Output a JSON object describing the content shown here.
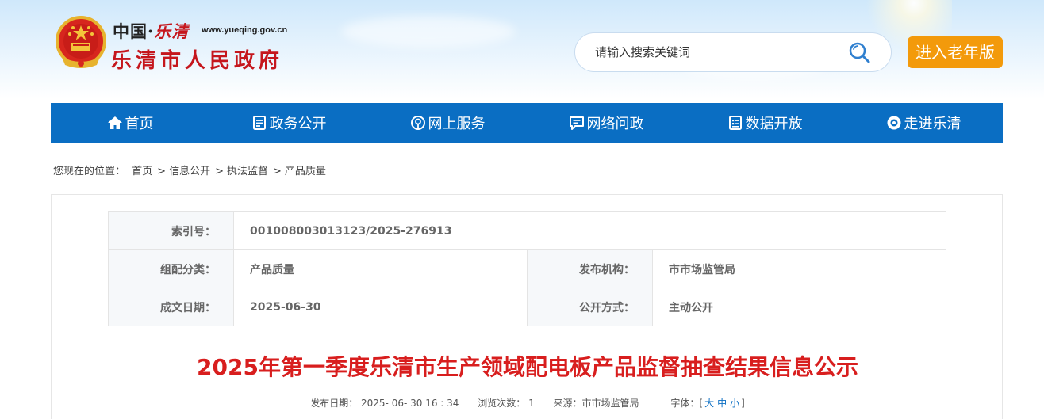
{
  "colors": {
    "nav_bg": "#0a6ec3",
    "elder_button_bg": "#f39a0b",
    "title_red": "#d81e1e",
    "logo_red": "#c5161d"
  },
  "header": {
    "logo_small_title_part1": "中国·",
    "logo_small_title_part2": "乐清",
    "logo_url": "www.yueqing.gov.cn",
    "logo_big_title": "乐清市人民政府",
    "search_placeholder": "请输入搜索关键词",
    "elder_button": "进入老年版"
  },
  "nav": {
    "items": [
      {
        "label": "首页",
        "icon": "home-icon"
      },
      {
        "label": "政务公开",
        "icon": "document-icon"
      },
      {
        "label": "网上服务",
        "icon": "service-icon"
      },
      {
        "label": "网络问政",
        "icon": "chat-icon"
      },
      {
        "label": "数据开放",
        "icon": "data-icon"
      },
      {
        "label": "走进乐清",
        "icon": "eye-icon"
      }
    ]
  },
  "breadcrumb": {
    "prefix": "您现在的位置：",
    "items": [
      "首页",
      "信息公开",
      "执法监督",
      "产品质量"
    ]
  },
  "meta": {
    "index_label": "索引号：",
    "index_value": "001008003013123/2025-276913",
    "category_label": "组配分类：",
    "category_value": "产品质量",
    "publisher_label": "发布机构：",
    "publisher_value": "市市场监管局",
    "date_label": "成文日期：",
    "date_value": "2025-06-30",
    "disclosure_label": "公开方式：",
    "disclosure_value": "主动公开"
  },
  "article": {
    "title": "2025年第一季度乐清市生产领域配电板产品监督抽查结果信息公示",
    "publish_date": "发布日期： 2025- 06- 30 16 : 34",
    "views": "浏览次数： 1",
    "source": "来源：市市场监管局",
    "font_label": "字体：[",
    "font_large": "大",
    "font_medium": "中",
    "font_small": "小",
    "font_end": "]"
  }
}
